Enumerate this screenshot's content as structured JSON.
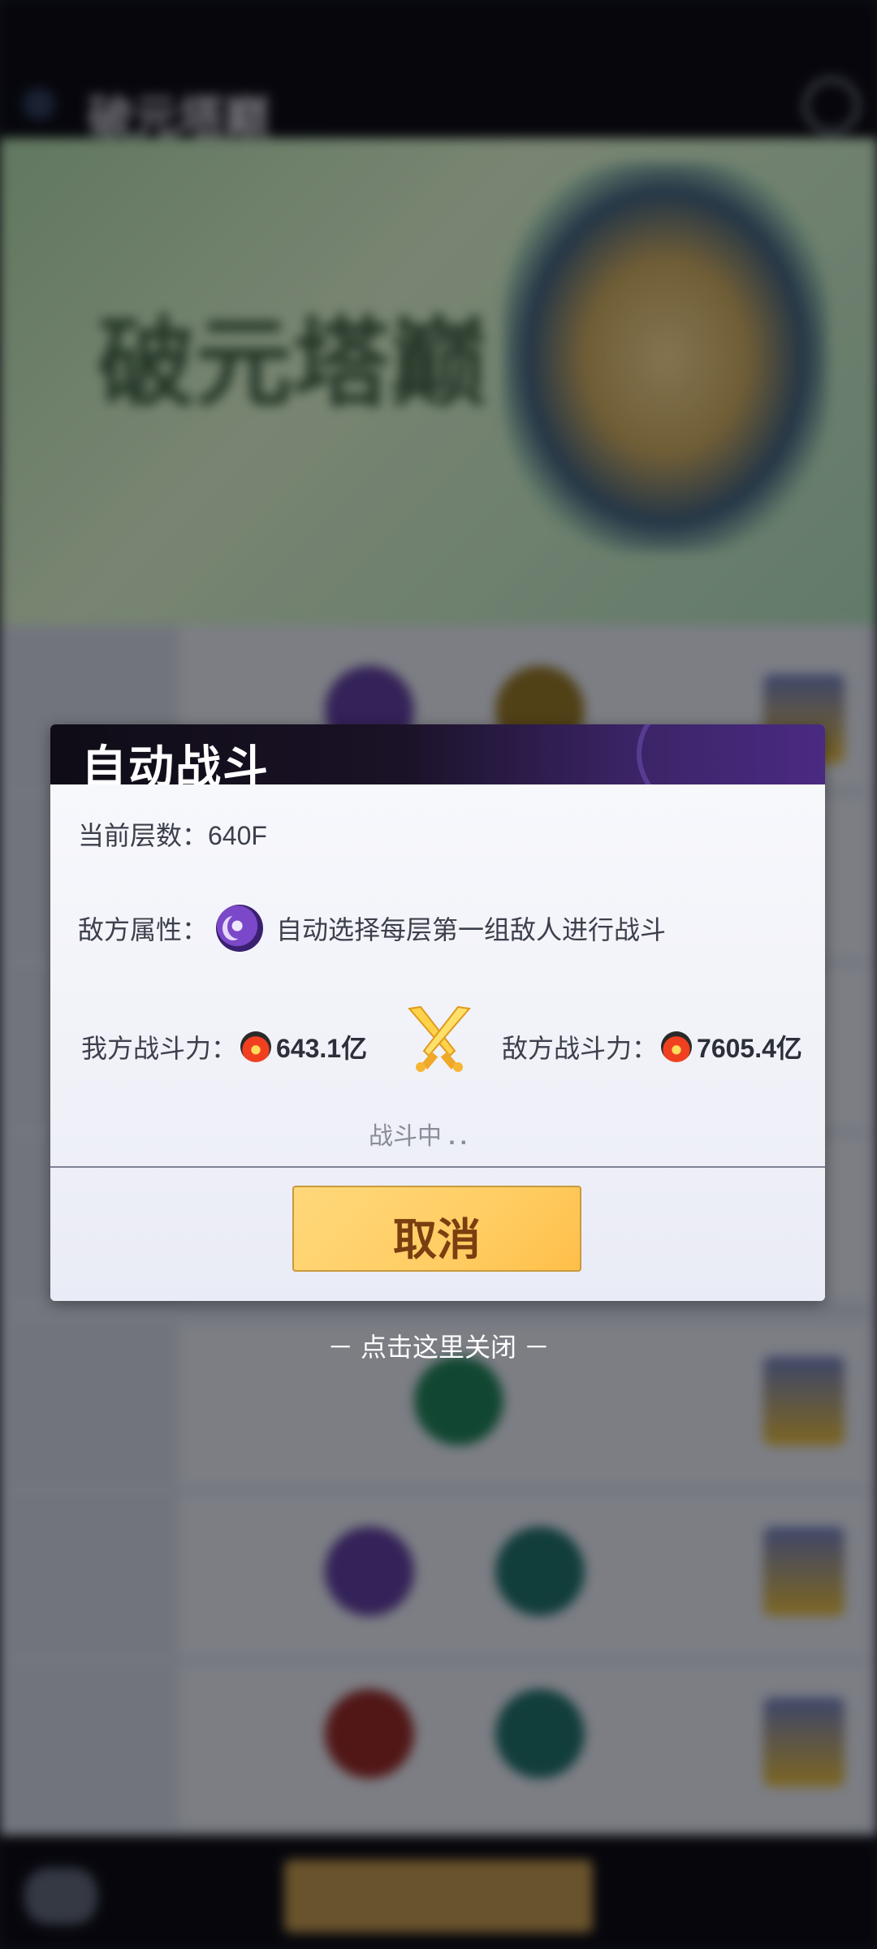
{
  "background": {
    "header_title": "破元塔巅",
    "banner_title": "破元塔巅",
    "banner_subtitle": "",
    "rows": []
  },
  "dialog": {
    "title": "自动战斗",
    "current_floor": "当前层数：640F",
    "enemy_attr_label": "敌方属性：",
    "enemy_attr_icon": "moon-element-icon",
    "enemy_attr_text": "自动选择每层第一组敌人进行战斗",
    "my_power_label": "我方战斗力：",
    "my_power_value": "643.1亿",
    "enemy_power_label": "敌方战斗力：",
    "enemy_power_value": "7605.4亿",
    "status_text": "战斗中",
    "status_dots": "..",
    "cancel_label": "取消"
  },
  "close_hint": "－ 点击这里关闭 －",
  "colors": {
    "header_dark": "#0f0c16",
    "header_purple": "#4a2a82",
    "button_gold": "#ffcd63",
    "button_text": "#7a3e10"
  }
}
